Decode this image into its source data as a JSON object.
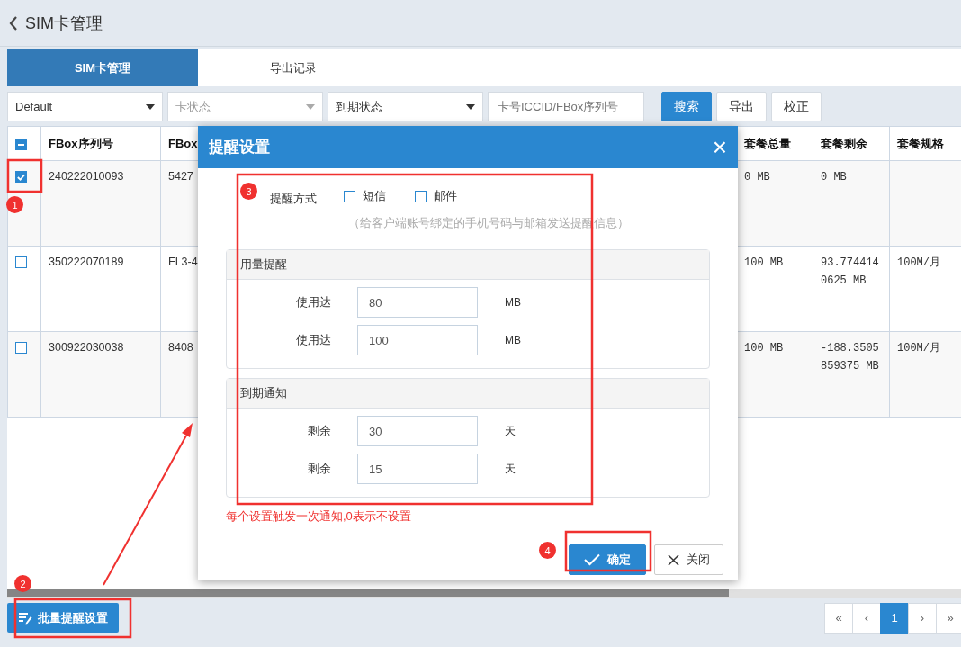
{
  "header": {
    "title": "SIM卡管理"
  },
  "tabs": [
    {
      "label": "SIM卡管理",
      "selected": true
    },
    {
      "label": "导出记录",
      "selected": false
    }
  ],
  "filters": [
    {
      "kind": "select",
      "value": "Default"
    },
    {
      "kind": "select",
      "placeholder": "卡状态"
    },
    {
      "kind": "select",
      "value": "到期状态"
    },
    {
      "kind": "input",
      "placeholder": "卡号ICCID/FBox序列号"
    }
  ],
  "filter_buttons": [
    {
      "label": "搜索",
      "primary": true
    },
    {
      "label": "导出",
      "primary": false
    },
    {
      "label": "校正",
      "primary": false
    }
  ],
  "table": {
    "header_checkbox": {
      "indeterminate": true
    },
    "columns": [
      "FBox序列号",
      "FBox",
      "套餐总量",
      "套餐剩余",
      "套餐规格"
    ],
    "rows": [
      {
        "selected": true,
        "cells": [
          "240222010093",
          "5427",
          "0 MB",
          "0 MB"
        ]
      },
      {
        "selected": false,
        "cells": [
          "350222070189",
          "FL3-4",
          "100 MB",
          "93.7744140625 MB",
          "100M/月"
        ]
      },
      {
        "selected": false,
        "cells": [
          "300922030038",
          "8408",
          "100 MB",
          "-188.3505859375 MB",
          "100M/月"
        ]
      }
    ]
  },
  "bulk_button": {
    "label": "批量提醒设置"
  },
  "pagination": [
    {
      "label": "«",
      "selected": false
    },
    {
      "label": "‹",
      "selected": false
    },
    {
      "label": "1",
      "selected": true
    },
    {
      "label": "›",
      "selected": false
    },
    {
      "label": "»",
      "selected": false
    }
  ],
  "dialog": {
    "title": "提醒设置",
    "close": "×",
    "method_label": "提醒方式",
    "methods": [
      {
        "label": "短信",
        "checked": false
      },
      {
        "label": "邮件",
        "checked": false
      }
    ],
    "hint": "（给客户端账号绑定的手机号码与邮箱发送提醒信息）",
    "panels": [
      {
        "title": "用量提醒",
        "rows": [
          {
            "label": "使用达",
            "value": "80",
            "unit": "MB"
          },
          {
            "label": "使用达",
            "value": "100",
            "unit": "MB"
          }
        ]
      },
      {
        "title": "到期通知",
        "rows": [
          {
            "label": "剩余",
            "value": "30",
            "unit": "天"
          },
          {
            "label": "剩余",
            "value": "15",
            "unit": "天"
          }
        ]
      }
    ],
    "note": "每个设置触发一次通知,0表示不设置",
    "buttons": [
      {
        "label": "确定",
        "kind": "confirm"
      },
      {
        "label": "关闭",
        "kind": "cancel"
      }
    ]
  },
  "annotations": [
    {
      "number": "1"
    },
    {
      "number": "2"
    },
    {
      "number": "3"
    },
    {
      "number": "4"
    }
  ]
}
